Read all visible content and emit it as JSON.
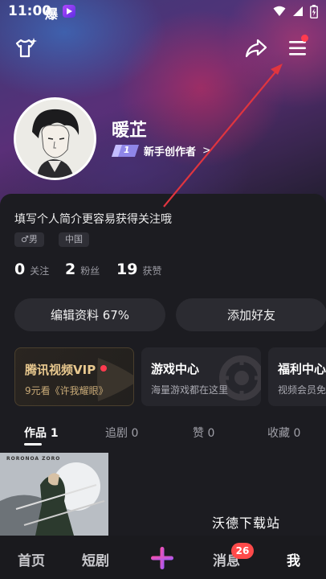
{
  "status_bar": {
    "time": "11:00",
    "flame_glyph": "爆"
  },
  "profile": {
    "username": "暖芷",
    "level": "1",
    "creator_label": "新手创作者",
    "bio": "填写个人简介更容易获得关注哦",
    "tags": [
      "♂男",
      "中国"
    ]
  },
  "stats": [
    {
      "value": "0",
      "label": "关注"
    },
    {
      "value": "2",
      "label": "粉丝"
    },
    {
      "value": "19",
      "label": "获赞"
    }
  ],
  "actions": {
    "edit_profile": "编辑资料 67%",
    "add_friend": "添加好友"
  },
  "services": [
    {
      "title": "腾讯视频VIP",
      "subtitle": "9元看《许我耀眼》"
    },
    {
      "title": "游戏中心",
      "subtitle": "海量游戏都在这里"
    },
    {
      "title": "福利中心",
      "subtitle": "视频会员免"
    }
  ],
  "tabs": [
    {
      "label": "作品 1"
    },
    {
      "label": "追剧 0"
    },
    {
      "label": "赞 0"
    },
    {
      "label": "收藏 0"
    }
  ],
  "post": {
    "thumbnail_text": "RORONOA ZORO"
  },
  "watermark": "沃德下载站",
  "bottom_nav": {
    "home": "首页",
    "short_drama": "短剧",
    "messages": "消息",
    "messages_badge": "26",
    "me": "我"
  },
  "icons": [
    "t-shirt-icon",
    "share-icon",
    "menu-icon",
    "wifi-icon",
    "signal-icon",
    "battery-icon",
    "plus-icon"
  ],
  "colors": {
    "accent_red": "#ff3b4f",
    "vip_gold": "#e9c98f",
    "annotation_arrow": "#e0353f"
  }
}
